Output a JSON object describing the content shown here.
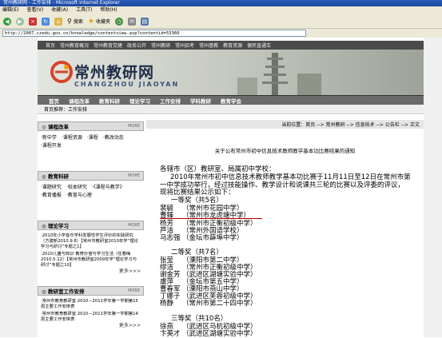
{
  "window": {
    "title": "常州教研网 - 工作安排 - Microsoft Internet Explorer"
  },
  "menu": [
    "编辑(E)",
    "查看(V)",
    "收藏(A)",
    "工具(T)",
    "帮助(H)"
  ],
  "toolbar": {
    "search_label": "搜索",
    "favorites_label": "收藏夹"
  },
  "address": {
    "url": "http://2007.czedu.gov.cn/knowledge/contentview.asp?contentid=53360"
  },
  "topnav": [
    "首页",
    "常州教育概况",
    "常州教育党建",
    "政务公开",
    "常州教研",
    "常州招考",
    "常州基教",
    "教育资源",
    "便民直通车"
  ],
  "banner": {
    "title_cn": "常州教研网",
    "title_en": "CHANGZHOU JIAOYAN"
  },
  "mainnav": [
    "首页",
    "课程改革",
    "教育科研",
    "理论学习",
    "工作安排",
    "学科教研",
    "教育学会"
  ],
  "crumb": "首页推荐：工作安排",
  "sidebar": {
    "more": "MORE",
    "panels": [
      {
        "title": "课程改革",
        "items": [
          "新中学",
          "课程资源",
          "课程",
          "教改动态",
          "课程开发"
        ],
        "more_link": ""
      },
      {
        "title": "教育科研",
        "items": [
          "课题研究",
          "校本研究",
          "《课程与教学》",
          "教育播报",
          "教育与心理"
        ],
        "more_link": ""
      },
      {
        "title": "理论学习",
        "items": [
          "2010年小学音乐学科发展性学生评价的实践研究（方建新2010.9.8）【常州市教研室2010年学“理论学习与研讨”专题之1】",
          "2010儿童与知识 教育价值与学习生活（任春梅2010.5.12）【常州市教研室2009年学“理论学习与研讨”专题之10】"
        ],
        "more_link": "更多>>>"
      },
      {
        "title": "教研室工作安排",
        "items": [
          "常州市教育教研室 2010－2011学年第一学期第15周主要工作安排表",
          "常州市教育教研室 2010－2011学年第一学期第14周主要工作安排表"
        ],
        "more_link": "更多>>>"
      }
    ]
  },
  "article": {
    "position": "当前位置：首页 --> 常州教研 --> 信息技术 --> 公告栏 --> 正文",
    "title": "关于公布常州市初中信息技术教师教学基本功比赛结果的通知",
    "salutation": "各辖市（区）教研室、局属初中学校：",
    "intro1": "2010年常州市初中信息技术教师教学基本功比赛于11月11日至12日在常州市第",
    "intro2": "一中学成功举行，经过技能操作、教学设计和说课共三轮的比赛以及评委的评议，",
    "intro3": "现将比赛结果公示如下：",
    "first_prize": "一等奖（共5名）",
    "first": [
      {
        "name": "裴毓",
        "school": "（常州市花园中学）"
      },
      {
        "name": "曹臻",
        "school": "（常州市龙虎塘中学）"
      },
      {
        "name": "杨芳",
        "school": "（常州市正衡初级中学）"
      },
      {
        "name": "芦洁",
        "school": "（常州外国语学校）"
      },
      {
        "name": "马志强",
        "school": "（金坛市薛埠中学）"
      }
    ],
    "second_prize": "二等奖（共7名）",
    "second": [
      {
        "name": "张莹",
        "school": "（溧阳市第二中学）"
      },
      {
        "name": "缪洁",
        "school": "（常州市正衡初级中学）"
      },
      {
        "name": "谢金芳",
        "school": "（武进区湖塘实验中学）"
      },
      {
        "name": "虞萍",
        "school": "（金坛市第五中学）"
      },
      {
        "name": "曹春军",
        "school": "（溧阳市燕山中学）"
      },
      {
        "name": "丁娜子",
        "school": "（武进区芙蓉初级中学）"
      },
      {
        "name": "杨静",
        "school": "（常州市第二十四中学）"
      }
    ],
    "third_prize": "三等奖（共10名）",
    "third": [
      {
        "name": "徐燕",
        "school": "（武进区马杭初级中学）"
      },
      {
        "name": "卞英才",
        "school": "（武进区湖塘实验中学）"
      }
    ]
  },
  "colors": {
    "ie_blue": "#1c46a0",
    "ie_gray": "#ece9d8",
    "nav_dark": "#4a4a4a",
    "underline_red": "#c00000"
  }
}
